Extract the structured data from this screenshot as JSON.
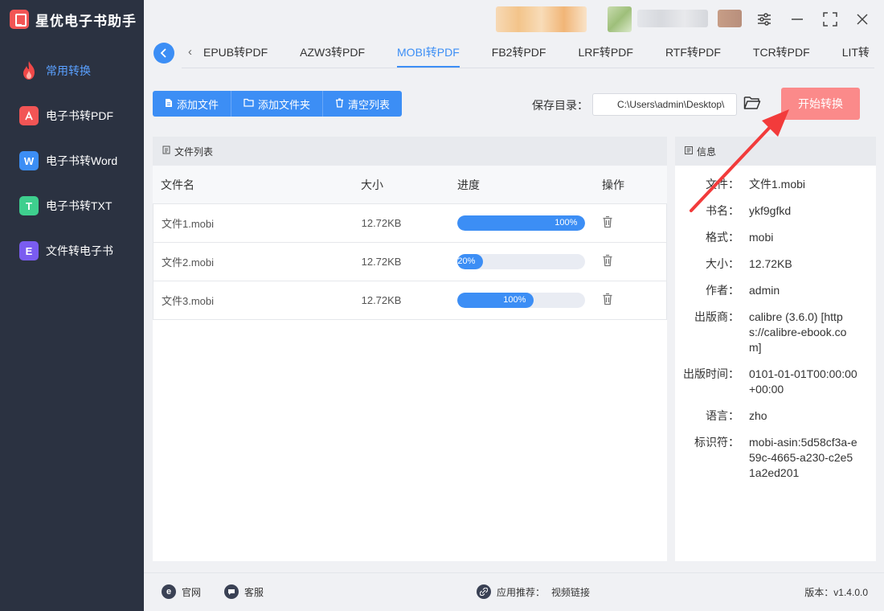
{
  "app": {
    "title": "星优电子书助手"
  },
  "sidebar": {
    "items": [
      {
        "label": "常用转换",
        "icon": "fire-icon",
        "color": "#f04848",
        "active": true
      },
      {
        "label": "电子书转PDF",
        "icon": "pdf-icon",
        "color": "#f25555",
        "glyph": "⅄"
      },
      {
        "label": "电子书转Word",
        "icon": "word-icon",
        "color": "#3c8ef5",
        "glyph": "W"
      },
      {
        "label": "电子书转TXT",
        "icon": "txt-icon",
        "color": "#3ecf8e",
        "glyph": "T"
      },
      {
        "label": "文件转电子书",
        "icon": "ebook-icon",
        "color": "#7a5cf0",
        "glyph": "E"
      }
    ]
  },
  "tabs": [
    {
      "label": "EPUB转PDF"
    },
    {
      "label": "AZW3转PDF"
    },
    {
      "label": "MOBI转PDF",
      "active": true
    },
    {
      "label": "FB2转PDF"
    },
    {
      "label": "LRF转PDF"
    },
    {
      "label": "RTF转PDF"
    },
    {
      "label": "TCR转PDF"
    },
    {
      "label": "LIT转"
    }
  ],
  "toolbar": {
    "add_file": "添加文件",
    "add_folder": "添加文件夹",
    "clear_list": "清空列表",
    "save_label": "保存目录：",
    "save_path": "C:\\Users\\admin\\Desktop\\",
    "start": "开始转换"
  },
  "file_list": {
    "title": "文件列表",
    "columns": {
      "name": "文件名",
      "size": "大小",
      "progress": "进度",
      "action": "操作"
    },
    "rows": [
      {
        "name": "文件1.mobi",
        "size": "12.72KB",
        "progress": 100,
        "progress_text": "100%"
      },
      {
        "name": "文件2.mobi",
        "size": "12.72KB",
        "progress": 20,
        "progress_text": "20%"
      },
      {
        "name": "文件3.mobi",
        "size": "12.72KB",
        "progress": 60,
        "progress_text": "100%"
      }
    ]
  },
  "info": {
    "title": "信息",
    "rows": [
      {
        "key": "文件：",
        "value": "文件1.mobi"
      },
      {
        "key": "书名：",
        "value": "ykf9gfkd"
      },
      {
        "key": "格式：",
        "value": "mobi"
      },
      {
        "key": "大小：",
        "value": "12.72KB"
      },
      {
        "key": "作者：",
        "value": "admin"
      },
      {
        "key": "出版商：",
        "value": "calibre (3.6.0) [https://calibre-ebook.com]"
      },
      {
        "key": "出版时间：",
        "value": "0101-01-01T00:00:00+00:00"
      },
      {
        "key": "语言：",
        "value": "zho"
      },
      {
        "key": "标识符：",
        "value": "mobi-asin:5d58cf3a-e59c-4665-a230-c2e51a2ed201"
      }
    ]
  },
  "footer": {
    "website": "官网",
    "support": "客服",
    "recommend": "应用推荐：",
    "video_link": "视频链接",
    "version": "版本：v1.4.0.0"
  },
  "colors": {
    "accent": "#3c8ef5",
    "start": "#fb8a8a",
    "sidebar": "#2b3241",
    "arrow": "#f23b3b"
  }
}
